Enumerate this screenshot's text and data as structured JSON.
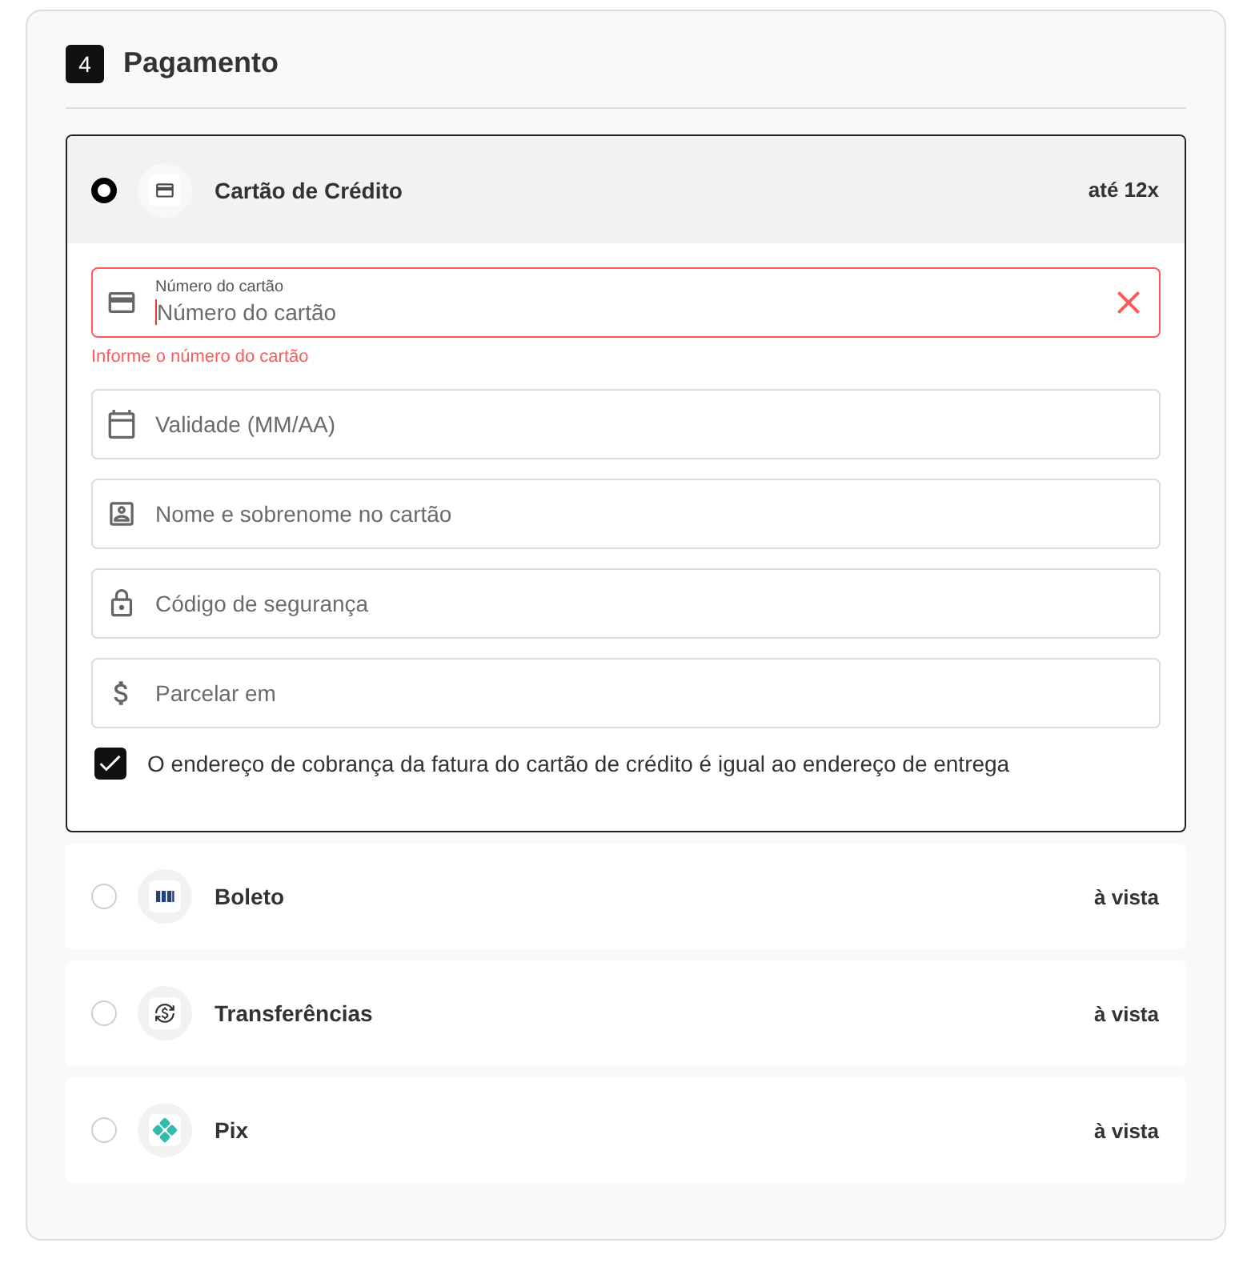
{
  "section": {
    "step": "4",
    "title": "Pagamento"
  },
  "payment_methods": [
    {
      "kind": "card",
      "label": "Cartão de Crédito",
      "terms": "até 12x",
      "selected": true,
      "form": {
        "fields": [
          {
            "kind": "card_number",
            "label": "Número do cartão",
            "placeholder": "Número do cartão",
            "focused": true,
            "invalid": true,
            "error": "Informe o número do cartão"
          },
          {
            "kind": "expiry",
            "placeholder": "Validade (MM/AA)",
            "focused": false,
            "invalid": false
          },
          {
            "kind": "name",
            "placeholder": "Nome e sobrenome no cartão",
            "focused": false,
            "invalid": false
          },
          {
            "kind": "cvv",
            "placeholder": "Código de segurança",
            "focused": false,
            "invalid": false
          },
          {
            "kind": "installments",
            "placeholder": "Parcelar em",
            "focused": false,
            "invalid": false
          }
        ],
        "billing_same_address": {
          "label": "O endereço de cobrança da fatura do cartão de crédito é igual ao endereço de entrega",
          "checked": true
        }
      }
    },
    {
      "kind": "boleto",
      "label": "Boleto",
      "terms": "à vista",
      "selected": false
    },
    {
      "kind": "transfer",
      "label": "Transferências",
      "terms": "à vista",
      "selected": false
    },
    {
      "kind": "pix",
      "label": "Pix",
      "terms": "à vista",
      "selected": false
    }
  ]
}
